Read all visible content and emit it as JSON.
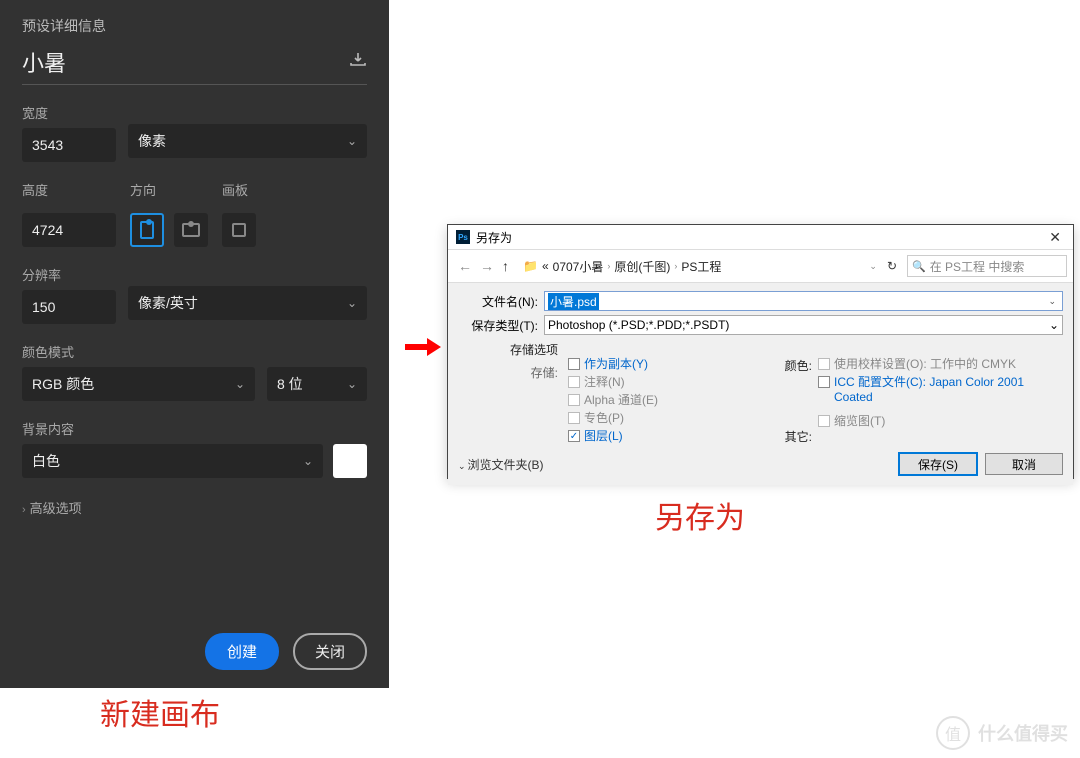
{
  "ps": {
    "preset_label": "预设详细信息",
    "preset_name": "小暑",
    "width_label": "宽度",
    "width_value": "3543",
    "width_unit": "像素",
    "height_label": "高度",
    "height_value": "4724",
    "orient_label": "方向",
    "artboard_label": "画板",
    "res_label": "分辨率",
    "res_value": "150",
    "res_unit": "像素/英寸",
    "colormode_label": "颜色模式",
    "colormode_value": "RGB 颜色",
    "bit_value": "8 位",
    "bg_label": "背景内容",
    "bg_value": "白色",
    "advanced_label": "高级选项",
    "create_btn": "创建",
    "close_btn": "关闭"
  },
  "saveas": {
    "title": "另存为",
    "path_seg1": "0707小暑",
    "path_seg2": "原创(千图)",
    "path_seg3": "PS工程",
    "search_placeholder": "在 PS工程 中搜索",
    "filename_label": "文件名(N):",
    "filename_value": "小暑.psd",
    "type_label": "保存类型(T):",
    "type_value": "Photoshop (*.PSD;*.PDD;*.PSDT)",
    "opts_header": "存储选项",
    "opts_store": "存储:",
    "chk_copy": "作为副本(Y)",
    "chk_notes": "注释(N)",
    "chk_alpha": "Alpha 通道(E)",
    "chk_spot": "专色(P)",
    "chk_layers": "图层(L)",
    "color_label": "颜色:",
    "chk_proof": "使用校样设置(O):  工作中的 CMYK",
    "chk_icc": "ICC 配置文件(C): Japan Color 2001 Coated",
    "other_label": "其它:",
    "chk_thumb": "缩览图(T)",
    "browse_label": "浏览文件夹(B)",
    "save_btn": "保存(S)",
    "cancel_btn": "取消"
  },
  "captions": {
    "left": "新建画布",
    "right": "另存为"
  },
  "watermark": {
    "char": "值",
    "text": "什么值得买"
  }
}
